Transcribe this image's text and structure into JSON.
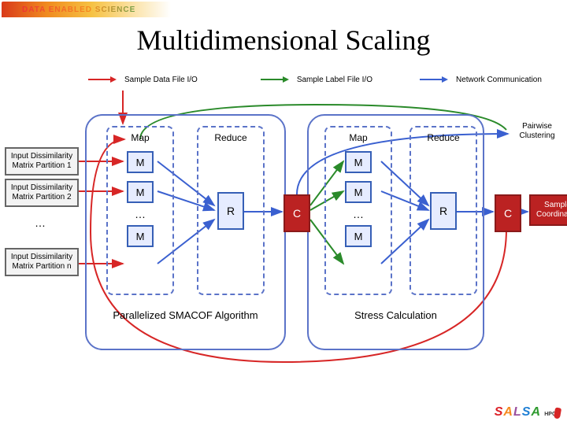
{
  "header": {
    "brand": "DATA ENABLED SCIENCE"
  },
  "title": "Multidimensional Scaling",
  "legend": {
    "red": "Sample Data File I/O",
    "green": "Sample Label File I/O",
    "blue": "Network Communication"
  },
  "inputs": {
    "p1": "Input Dissimilarity Matrix Partition 1",
    "p2": "Input Dissimilarity Matrix Partition 2",
    "dots": "…",
    "pn": "Input Dissimilarity Matrix Partition n"
  },
  "columns": {
    "map1": "Map",
    "reduce1": "Reduce",
    "map2": "Map",
    "reduce2": "Reduce"
  },
  "nodes": {
    "M": "M",
    "R": "R",
    "C": "C",
    "dots": "…"
  },
  "outputs": {
    "pairwise": "Pairwise Clustering",
    "coords": "Sample Coordinates"
  },
  "bottom": {
    "smacof": "Parallelized SMACOF Algorithm",
    "stress": "Stress Calculation"
  },
  "footer": {
    "salsa": "SALSA",
    "hpc": "HPC"
  }
}
